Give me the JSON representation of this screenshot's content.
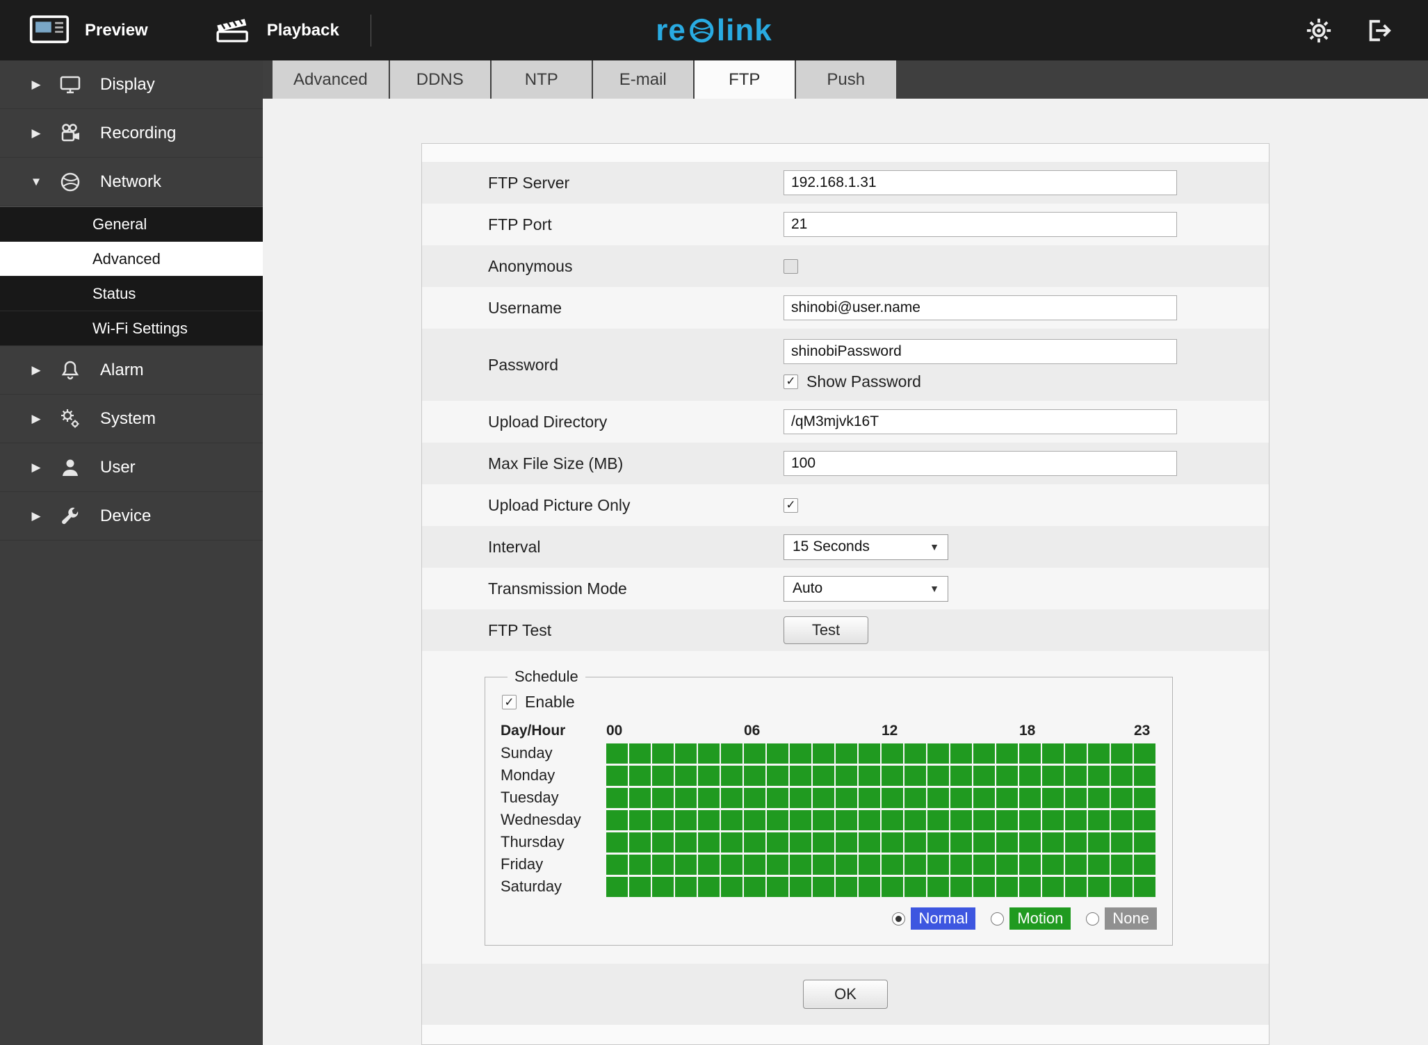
{
  "colors": {
    "logo": "#29abe2"
  },
  "topbar": {
    "preview_label": "Preview",
    "playback_label": "Playback",
    "logo_pre": "re",
    "logo_post": "link"
  },
  "sidebar": {
    "items": [
      {
        "label": "Display"
      },
      {
        "label": "Recording"
      },
      {
        "label": "Network",
        "expanded": true
      },
      {
        "label": "Alarm"
      },
      {
        "label": "System"
      },
      {
        "label": "User"
      },
      {
        "label": "Device"
      }
    ],
    "network_subitems": [
      {
        "label": "General"
      },
      {
        "label": "Advanced",
        "selected": true
      },
      {
        "label": "Status"
      },
      {
        "label": "Wi-Fi Settings"
      }
    ]
  },
  "tabs": [
    {
      "label": "Advanced"
    },
    {
      "label": "DDNS"
    },
    {
      "label": "NTP"
    },
    {
      "label": "E-mail"
    },
    {
      "label": "FTP",
      "active": true
    },
    {
      "label": "Push"
    }
  ],
  "form": {
    "ftp_server": {
      "label": "FTP Server",
      "value": "192.168.1.31"
    },
    "ftp_port": {
      "label": "FTP Port",
      "value": "21"
    },
    "anonymous": {
      "label": "Anonymous",
      "checked": false
    },
    "username": {
      "label": "Username",
      "value": "shinobi@user.name"
    },
    "password": {
      "label": "Password",
      "value": "shinobiPassword",
      "show_label": "Show Password",
      "show_checked": true
    },
    "upload_directory": {
      "label": "Upload Directory",
      "value": "/qM3mjvk16T"
    },
    "max_file_size": {
      "label": "Max File Size (MB)",
      "value": "100"
    },
    "upload_picture_only": {
      "label": "Upload Picture Only",
      "checked": true
    },
    "interval": {
      "label": "Interval",
      "value": "15 Seconds"
    },
    "transmission_mode": {
      "label": "Transmission Mode",
      "value": "Auto"
    },
    "ftp_test": {
      "label": "FTP Test",
      "button_label": "Test"
    }
  },
  "schedule": {
    "legend": "Schedule",
    "enable_label": "Enable",
    "enabled": true,
    "header": "Day/Hour",
    "hours": 24,
    "hour_labels": [
      {
        "i": 0,
        "t": "00"
      },
      {
        "i": 6,
        "t": "06"
      },
      {
        "i": 12,
        "t": "12"
      },
      {
        "i": 18,
        "t": "18"
      },
      {
        "i": 23,
        "t": "23"
      }
    ],
    "days": [
      "Sunday",
      "Monday",
      "Tuesday",
      "Wednesday",
      "Thursday",
      "Friday",
      "Saturday"
    ],
    "all_cells": "normal",
    "colors": {
      "normal": "#209a20"
    },
    "modes": [
      {
        "label": "Normal",
        "selected": true,
        "color": "#3d56e0"
      },
      {
        "label": "Motion",
        "selected": false,
        "color": "#209a20"
      },
      {
        "label": "None",
        "selected": false,
        "color": "#909090"
      }
    ]
  },
  "ok_label": "OK"
}
